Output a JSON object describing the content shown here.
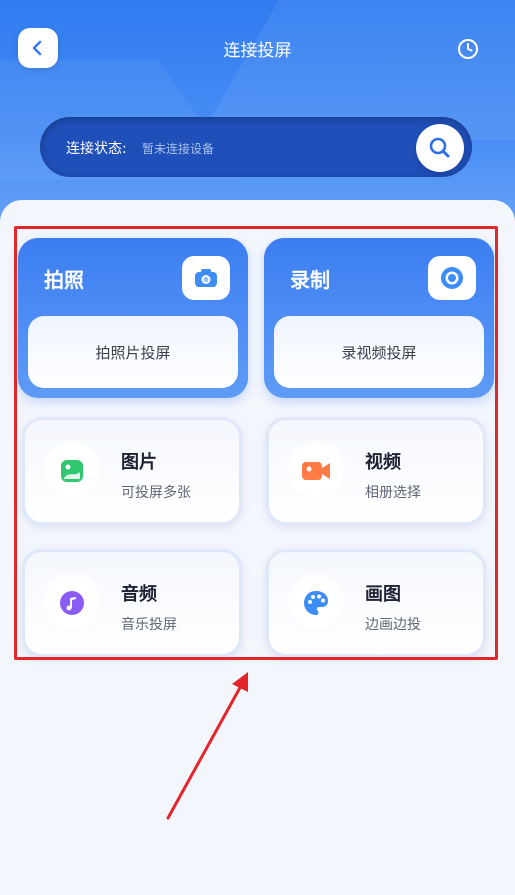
{
  "header": {
    "title": "连接投屏",
    "back_icon": "chevron-left-icon",
    "history_icon": "clock-icon"
  },
  "status": {
    "label": "连接状态:",
    "value": "暂未连接设备",
    "search_icon": "search-icon"
  },
  "big_cards": [
    {
      "title": "拍照",
      "subtitle": "拍照片投屏",
      "icon": "camera-icon"
    },
    {
      "title": "录制",
      "subtitle": "录视频投屏",
      "icon": "record-icon"
    }
  ],
  "small_cards": [
    {
      "title": "图片",
      "subtitle": "可投屏多张",
      "icon": "image-icon",
      "color": "#2fc870"
    },
    {
      "title": "视频",
      "subtitle": "相册选择",
      "icon": "video-camera-icon",
      "color": "#ff7a45"
    },
    {
      "title": "音频",
      "subtitle": "音乐投屏",
      "icon": "music-note-icon",
      "color": "#8a5cf5"
    },
    {
      "title": "画图",
      "subtitle": "边画边投",
      "icon": "palette-icon",
      "color": "#3c8df5"
    }
  ],
  "colors": {
    "primary": "#3c7ef2",
    "status_bar": "#1f4fb8",
    "highlight": "#e3262b"
  }
}
